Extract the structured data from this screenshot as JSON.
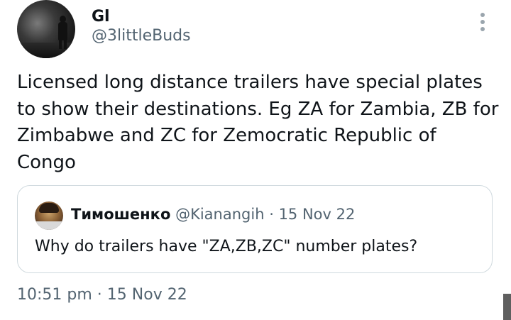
{
  "author": {
    "name": "Gl",
    "handle": "@3littleBuds"
  },
  "tweet": {
    "text": "Licensed long distance trailers have special plates to show their destinations. Eg ZA for Zambia, ZB for Zimbabwe and ZC for Zemocratic Republic of Congo",
    "time": "10:51 pm",
    "separator": "·",
    "date": "15 Nov 22"
  },
  "quoted": {
    "name": "Тимошенко",
    "handle": "@Kianangih",
    "separator": "·",
    "date": "15 Nov 22",
    "text": "Why do trailers have \"ZA,ZB,ZC\" number plates?"
  },
  "icons": {
    "more": "more-vertical-icon"
  },
  "colors": {
    "text": "#0f1419",
    "secondary": "#536471",
    "border": "#cfd9de"
  }
}
